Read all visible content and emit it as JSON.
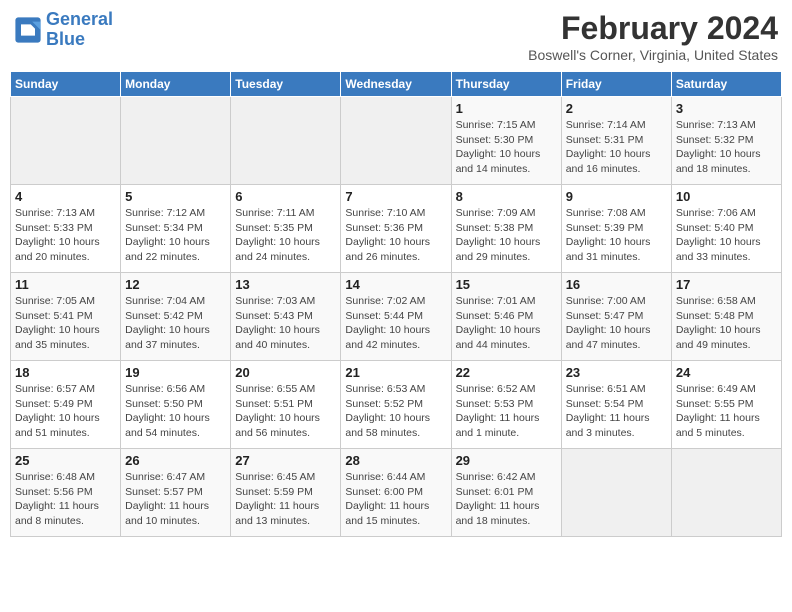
{
  "header": {
    "logo_line1": "General",
    "logo_line2": "Blue",
    "month": "February 2024",
    "location": "Boswell's Corner, Virginia, United States"
  },
  "days_of_week": [
    "Sunday",
    "Monday",
    "Tuesday",
    "Wednesday",
    "Thursday",
    "Friday",
    "Saturday"
  ],
  "weeks": [
    [
      {
        "num": "",
        "info": ""
      },
      {
        "num": "",
        "info": ""
      },
      {
        "num": "",
        "info": ""
      },
      {
        "num": "",
        "info": ""
      },
      {
        "num": "1",
        "info": "Sunrise: 7:15 AM\nSunset: 5:30 PM\nDaylight: 10 hours\nand 14 minutes."
      },
      {
        "num": "2",
        "info": "Sunrise: 7:14 AM\nSunset: 5:31 PM\nDaylight: 10 hours\nand 16 minutes."
      },
      {
        "num": "3",
        "info": "Sunrise: 7:13 AM\nSunset: 5:32 PM\nDaylight: 10 hours\nand 18 minutes."
      }
    ],
    [
      {
        "num": "4",
        "info": "Sunrise: 7:13 AM\nSunset: 5:33 PM\nDaylight: 10 hours\nand 20 minutes."
      },
      {
        "num": "5",
        "info": "Sunrise: 7:12 AM\nSunset: 5:34 PM\nDaylight: 10 hours\nand 22 minutes."
      },
      {
        "num": "6",
        "info": "Sunrise: 7:11 AM\nSunset: 5:35 PM\nDaylight: 10 hours\nand 24 minutes."
      },
      {
        "num": "7",
        "info": "Sunrise: 7:10 AM\nSunset: 5:36 PM\nDaylight: 10 hours\nand 26 minutes."
      },
      {
        "num": "8",
        "info": "Sunrise: 7:09 AM\nSunset: 5:38 PM\nDaylight: 10 hours\nand 29 minutes."
      },
      {
        "num": "9",
        "info": "Sunrise: 7:08 AM\nSunset: 5:39 PM\nDaylight: 10 hours\nand 31 minutes."
      },
      {
        "num": "10",
        "info": "Sunrise: 7:06 AM\nSunset: 5:40 PM\nDaylight: 10 hours\nand 33 minutes."
      }
    ],
    [
      {
        "num": "11",
        "info": "Sunrise: 7:05 AM\nSunset: 5:41 PM\nDaylight: 10 hours\nand 35 minutes."
      },
      {
        "num": "12",
        "info": "Sunrise: 7:04 AM\nSunset: 5:42 PM\nDaylight: 10 hours\nand 37 minutes."
      },
      {
        "num": "13",
        "info": "Sunrise: 7:03 AM\nSunset: 5:43 PM\nDaylight: 10 hours\nand 40 minutes."
      },
      {
        "num": "14",
        "info": "Sunrise: 7:02 AM\nSunset: 5:44 PM\nDaylight: 10 hours\nand 42 minutes."
      },
      {
        "num": "15",
        "info": "Sunrise: 7:01 AM\nSunset: 5:46 PM\nDaylight: 10 hours\nand 44 minutes."
      },
      {
        "num": "16",
        "info": "Sunrise: 7:00 AM\nSunset: 5:47 PM\nDaylight: 10 hours\nand 47 minutes."
      },
      {
        "num": "17",
        "info": "Sunrise: 6:58 AM\nSunset: 5:48 PM\nDaylight: 10 hours\nand 49 minutes."
      }
    ],
    [
      {
        "num": "18",
        "info": "Sunrise: 6:57 AM\nSunset: 5:49 PM\nDaylight: 10 hours\nand 51 minutes."
      },
      {
        "num": "19",
        "info": "Sunrise: 6:56 AM\nSunset: 5:50 PM\nDaylight: 10 hours\nand 54 minutes."
      },
      {
        "num": "20",
        "info": "Sunrise: 6:55 AM\nSunset: 5:51 PM\nDaylight: 10 hours\nand 56 minutes."
      },
      {
        "num": "21",
        "info": "Sunrise: 6:53 AM\nSunset: 5:52 PM\nDaylight: 10 hours\nand 58 minutes."
      },
      {
        "num": "22",
        "info": "Sunrise: 6:52 AM\nSunset: 5:53 PM\nDaylight: 11 hours\nand 1 minute."
      },
      {
        "num": "23",
        "info": "Sunrise: 6:51 AM\nSunset: 5:54 PM\nDaylight: 11 hours\nand 3 minutes."
      },
      {
        "num": "24",
        "info": "Sunrise: 6:49 AM\nSunset: 5:55 PM\nDaylight: 11 hours\nand 5 minutes."
      }
    ],
    [
      {
        "num": "25",
        "info": "Sunrise: 6:48 AM\nSunset: 5:56 PM\nDaylight: 11 hours\nand 8 minutes."
      },
      {
        "num": "26",
        "info": "Sunrise: 6:47 AM\nSunset: 5:57 PM\nDaylight: 11 hours\nand 10 minutes."
      },
      {
        "num": "27",
        "info": "Sunrise: 6:45 AM\nSunset: 5:59 PM\nDaylight: 11 hours\nand 13 minutes."
      },
      {
        "num": "28",
        "info": "Sunrise: 6:44 AM\nSunset: 6:00 PM\nDaylight: 11 hours\nand 15 minutes."
      },
      {
        "num": "29",
        "info": "Sunrise: 6:42 AM\nSunset: 6:01 PM\nDaylight: 11 hours\nand 18 minutes."
      },
      {
        "num": "",
        "info": ""
      },
      {
        "num": "",
        "info": ""
      }
    ]
  ]
}
